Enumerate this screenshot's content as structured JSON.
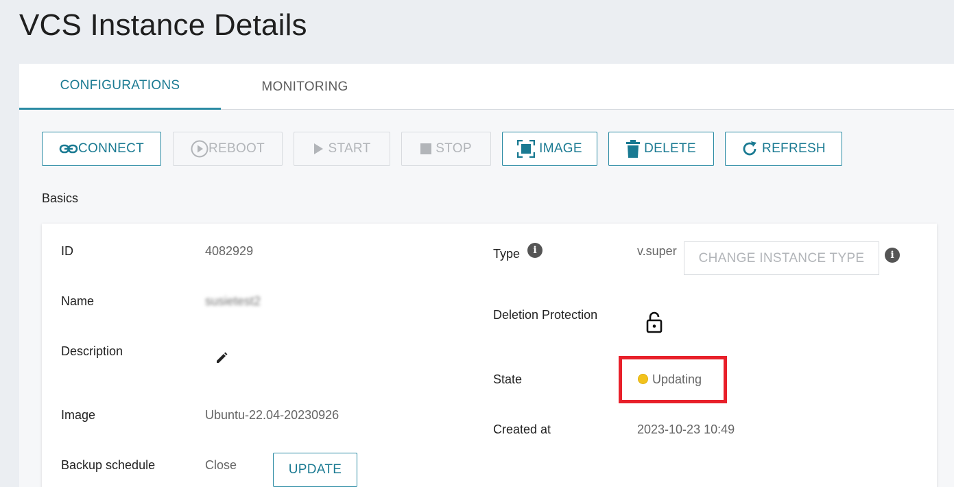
{
  "page": {
    "title": "VCS Instance Details"
  },
  "tabs": [
    {
      "label": "CONFIGURATIONS",
      "active": true
    },
    {
      "label": "MONITORING",
      "active": false
    }
  ],
  "actions": {
    "connect": {
      "label": "CONNECT",
      "icon": "link-icon",
      "enabled": true
    },
    "reboot": {
      "label": "REBOOT",
      "icon": "play-circle-icon",
      "enabled": false
    },
    "start": {
      "label": "START",
      "icon": "play-icon",
      "enabled": false
    },
    "stop": {
      "label": "STOP",
      "icon": "stop-icon",
      "enabled": false
    },
    "image": {
      "label": "IMAGE",
      "icon": "image-frame-icon",
      "enabled": true
    },
    "delete": {
      "label": "DELETE",
      "icon": "trash-icon",
      "enabled": true
    },
    "refresh": {
      "label": "REFRESH",
      "icon": "refresh-icon",
      "enabled": true
    }
  },
  "basics": {
    "section_label": "Basics",
    "id": {
      "label": "ID",
      "value": "4082929"
    },
    "name": {
      "label": "Name",
      "value": "susietest2"
    },
    "description": {
      "label": "Description",
      "icon": "pencil-icon"
    },
    "image": {
      "label": "Image",
      "value": "Ubuntu-22.04-20230926"
    },
    "backup_schedule": {
      "label": "Backup schedule",
      "value": "Close",
      "button_label": "UPDATE"
    },
    "type": {
      "label": "Type",
      "value": "v.super",
      "change_button_label": "CHANGE INSTANCE TYPE"
    },
    "deletion_protection": {
      "label": "Deletion Protection",
      "icon": "unlock-icon"
    },
    "state": {
      "label": "State",
      "value": "Updating",
      "status_color": "#f2c21c",
      "highlight_color": "#e8202a"
    },
    "created_at": {
      "label": "Created at",
      "value": "2023-10-23 10:49"
    }
  },
  "colors": {
    "accent": "#1a7a92",
    "page_background": "#ebeef2",
    "disabled_text": "#b2b5b9"
  }
}
